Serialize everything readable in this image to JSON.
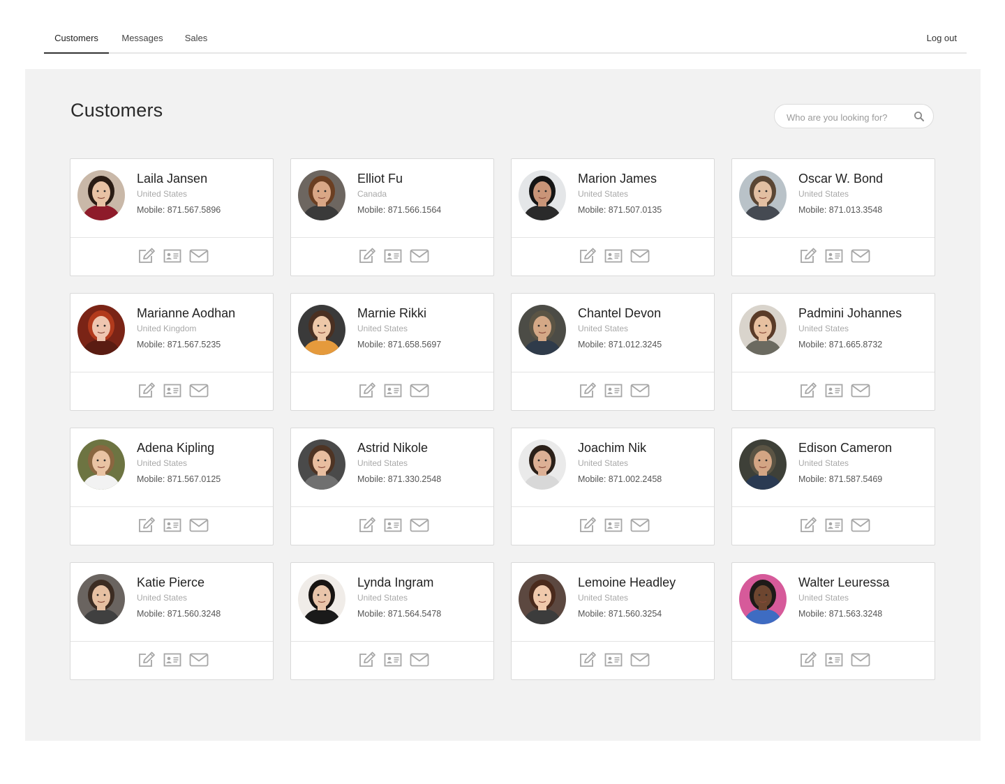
{
  "nav": {
    "tabs": [
      {
        "label": "Customers",
        "active": true
      },
      {
        "label": "Messages",
        "active": false
      },
      {
        "label": "Sales",
        "active": false
      }
    ],
    "logout_label": "Log out"
  },
  "page": {
    "title": "Customers",
    "search_placeholder": "Who are you looking for?"
  },
  "icons": {
    "search": "search-icon",
    "edit": "edit-icon",
    "contact_card": "contact-card-icon",
    "mail": "mail-icon"
  },
  "colors": {
    "panel_bg": "#f2f2f2",
    "icon_gray": "#a6a6a6",
    "active_tab_underline": "#333333"
  },
  "customers": [
    {
      "name": "Laila Jansen",
      "country": "United States",
      "mobile": "Mobile: 871.567.5896"
    },
    {
      "name": "Elliot Fu",
      "country": "Canada",
      "mobile": "Mobile: 871.566.1564"
    },
    {
      "name": "Marion James",
      "country": "United States",
      "mobile": "Mobile: 871.507.0135"
    },
    {
      "name": "Oscar W. Bond",
      "country": "United States",
      "mobile": "Mobile: 871.013.3548"
    },
    {
      "name": "Marianne Aodhan",
      "country": "United Kingdom",
      "mobile": "Mobile: 871.567.5235"
    },
    {
      "name": "Marnie Rikki",
      "country": "United States",
      "mobile": "Mobile: 871.658.5697"
    },
    {
      "name": "Chantel Devon",
      "country": "United States",
      "mobile": "Mobile: 871.012.3245"
    },
    {
      "name": "Padmini Johannes",
      "country": "United States",
      "mobile": "Mobile: 871.665.8732"
    },
    {
      "name": "Adena Kipling",
      "country": "United States",
      "mobile": "Mobile: 871.567.0125"
    },
    {
      "name": "Astrid Nikole",
      "country": "United States",
      "mobile": "Mobile: 871.330.2548"
    },
    {
      "name": "Joachim Nik",
      "country": "United States",
      "mobile": "Mobile: 871.002.2458"
    },
    {
      "name": "Edison Cameron",
      "country": "United States",
      "mobile": "Mobile: 871.587.5469"
    },
    {
      "name": "Katie Pierce",
      "country": "United States",
      "mobile": "Mobile: 871.560.3248"
    },
    {
      "name": "Lynda Ingram",
      "country": "United States",
      "mobile": "Mobile: 871.564.5478"
    },
    {
      "name": "Lemoine Headley",
      "country": "United States",
      "mobile": "Mobile: 871.560.3254"
    },
    {
      "name": "Walter Leuressa",
      "country": "United States",
      "mobile": "Mobile: 871.563.3248"
    }
  ]
}
